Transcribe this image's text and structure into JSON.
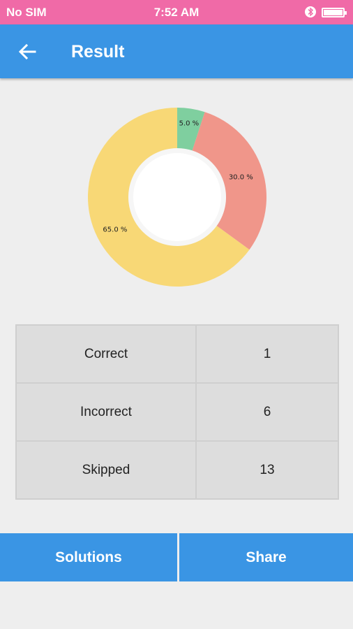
{
  "status_bar": {
    "carrier": "No SIM",
    "time": "7:52 AM",
    "bluetooth_icon": "bluetooth-icon",
    "battery_icon": "battery-icon"
  },
  "app_bar": {
    "title": "Result",
    "back_icon": "arrow-left-icon"
  },
  "colors": {
    "status_bar": "#f06aa7",
    "primary": "#3a95e4",
    "correct": "#7fcf9f",
    "incorrect": "#f0968a",
    "skipped": "#f8d876"
  },
  "chart_data": {
    "type": "pie",
    "hole": true,
    "slices": [
      {
        "label": "5.0 %",
        "value": 5.0,
        "color": "#7fcf9f"
      },
      {
        "label": "30.0 %",
        "value": 30.0,
        "color": "#f0968a"
      },
      {
        "label": "65.0 %",
        "value": 65.0,
        "color": "#f8d876"
      }
    ]
  },
  "results": [
    {
      "label": "Correct",
      "value": "1"
    },
    {
      "label": "Incorrect",
      "value": "6"
    },
    {
      "label": "Skipped",
      "value": "13"
    }
  ],
  "actions": {
    "solutions_label": "Solutions",
    "share_label": "Share"
  }
}
